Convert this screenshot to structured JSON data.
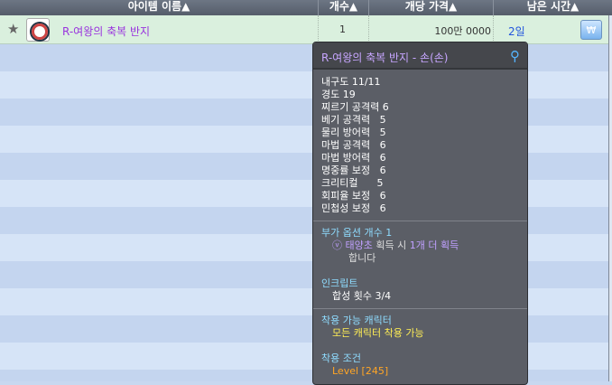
{
  "header": {
    "name": "아이템 이름▲",
    "count": "개수▲",
    "price": "개당 가격▲",
    "time": "남은 시간▲"
  },
  "row": {
    "name": "R-여왕의 축복 반지",
    "count": "1",
    "price": "100만 0000",
    "time": "2일",
    "star_icon": "★",
    "bag_icon": "₩"
  },
  "tooltip": {
    "title": "R-여왕의 축복 반지 - 손(손)",
    "stats": [
      "내구도 11/11",
      "경도 19",
      "찌르기 공격력 6",
      "베기 공격력   5",
      "물리 방어력   5",
      "마법 공격력   6",
      "마법 방어력   6",
      "명중률 보정   6",
      "크리티컬      5",
      "회피율 보정   6",
      "민첩성 보정   6"
    ],
    "option_header": "부가 옵션 개수 1",
    "option_mark": "ⓥ",
    "option_item": "태양초",
    "option_text1": " 획득 시 ",
    "option_text2": "1개 더 획득",
    "option_text3": "합니다",
    "inscript_header": "인크립트",
    "inscript_value": "합성 횟수 3/4",
    "char_header": "착용 가능 캐릭터",
    "char_value": "모든 캐릭터 착용 가능",
    "cond_header": "착용 조건",
    "cond_value": "Level [245]"
  }
}
